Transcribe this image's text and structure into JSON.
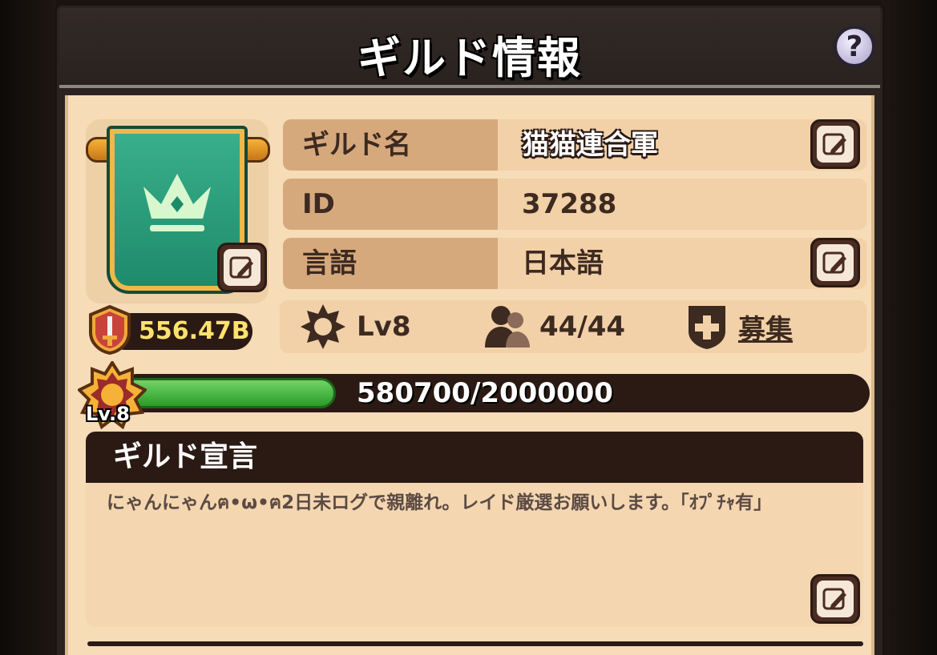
{
  "header": {
    "title": "ギルド情報",
    "help_label": "?"
  },
  "guild": {
    "name_label": "ギルド名",
    "name_value": "猫猫連合軍",
    "id_label": "ID",
    "id_value": "37288",
    "lang_label": "言語",
    "lang_value": "日本語",
    "power": "556.47B"
  },
  "stats": {
    "level": "Lv8",
    "members": "44/44",
    "recruit": "募集"
  },
  "exp": {
    "text": "580700/2000000",
    "current": 580700,
    "max": 2000000,
    "badge_level": "Lv.8"
  },
  "declaration": {
    "title": "ギルド宣言",
    "text": "にゃんにゃんฅ•ω•ฅ2日未ログで親離れ。レイド厳選お願いします。「ｵﾌﾟﾁｬ有」"
  },
  "colors": {
    "panel": "#2b2320",
    "content": "#f6dcb7",
    "label_bg": "#d6a97d",
    "row_bg": "#f2d1a8",
    "progress": "#2b9b28",
    "power_text": "#ffe26b"
  }
}
